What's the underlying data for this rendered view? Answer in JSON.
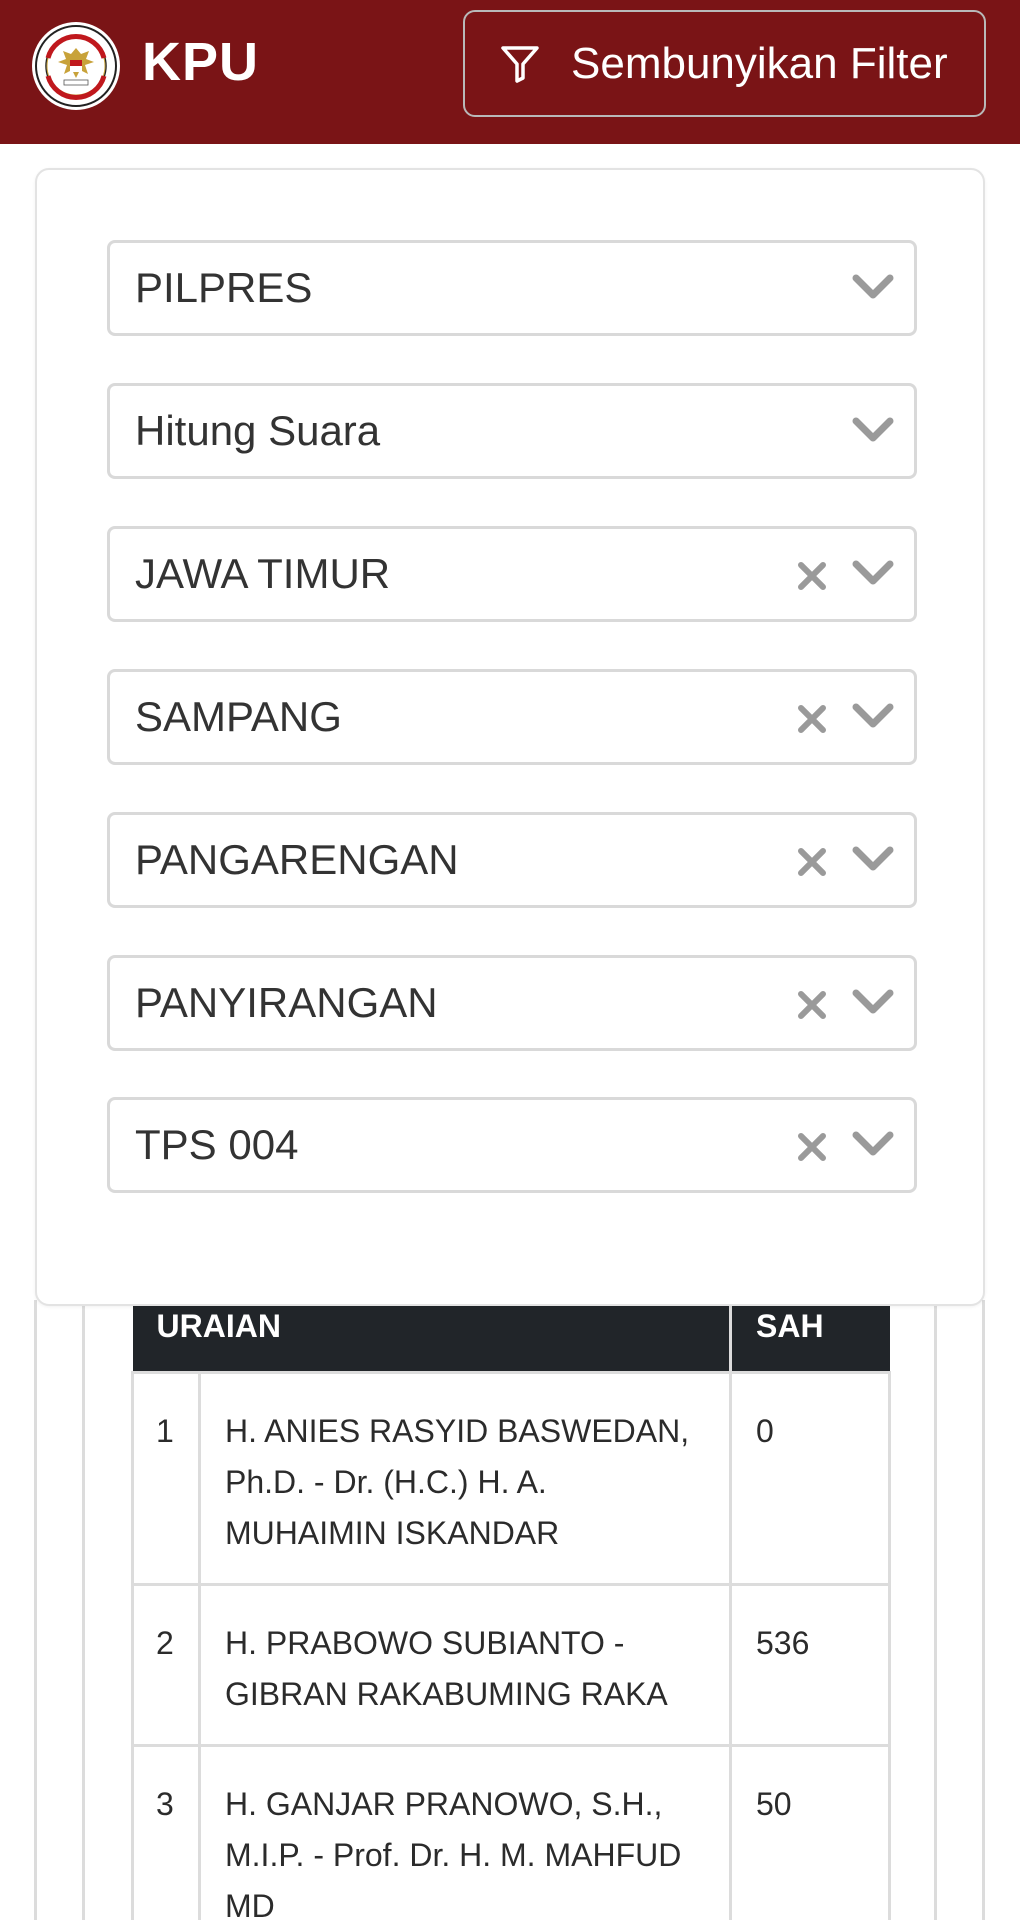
{
  "header": {
    "brand": "KPU",
    "logo_icon": "kpu-garuda-emblem-icon",
    "filter_button": {
      "label": "Sembunyikan Filter",
      "icon": "funnel-icon"
    },
    "colors": {
      "header_bg": "#7a1416",
      "text": "#ffffff"
    }
  },
  "filters": [
    {
      "value": "PILPRES",
      "clearable": false
    },
    {
      "value": "Hitung Suara",
      "clearable": false
    },
    {
      "value": "JAWA TIMUR",
      "clearable": true
    },
    {
      "value": "SAMPANG",
      "clearable": true
    },
    {
      "value": "PANGARENGAN",
      "clearable": true
    },
    {
      "value": "PANYIRANGAN",
      "clearable": true
    },
    {
      "value": "TPS 004",
      "clearable": true
    }
  ],
  "table": {
    "headers": {
      "uraian": "URAIAN",
      "sah": "SAH"
    },
    "rows": [
      {
        "no": "1",
        "name": "H. ANIES RASYID BASWEDAN, Ph.D. - Dr. (H.C.) H. A. MUHAIMIN ISKANDAR",
        "sah": "0"
      },
      {
        "no": "2",
        "name": "H. PRABOWO SUBIANTO - GIBRAN RAKABUMING RAKA",
        "sah": "536"
      },
      {
        "no": "3",
        "name": "H. GANJAR PRANOWO, S.H., M.I.P. - Prof. Dr. H. M. MAHFUD MD",
        "sah": "50"
      }
    ]
  }
}
